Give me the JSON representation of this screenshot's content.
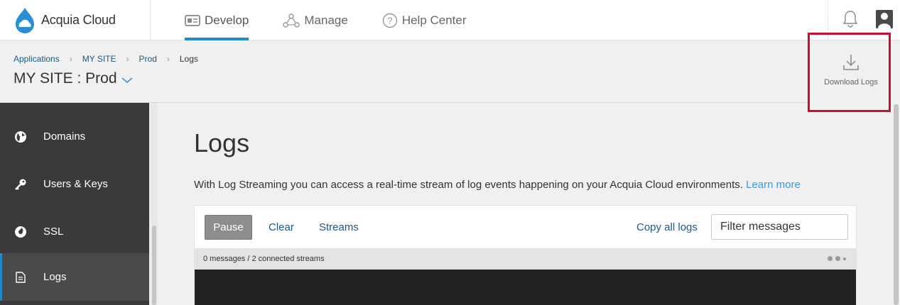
{
  "brand": {
    "name": "Acquia Cloud",
    "logo_icon": "acquia-cloud-logo"
  },
  "nav": {
    "items": [
      {
        "label": "Develop",
        "icon": "develop-icon",
        "active": true
      },
      {
        "label": "Manage",
        "icon": "manage-icon",
        "active": false
      },
      {
        "label": "Help Center",
        "icon": "help-icon",
        "active": false
      }
    ]
  },
  "breadcrumb": {
    "items": [
      "Applications",
      "MY SITE",
      "Prod"
    ],
    "current": "Logs"
  },
  "environment": {
    "title": "MY SITE : Prod"
  },
  "download": {
    "label": "Download Logs"
  },
  "sidebar": {
    "items": [
      {
        "label": "Domains",
        "icon": "globe-icon"
      },
      {
        "label": "Users & Keys",
        "icon": "key-icon"
      },
      {
        "label": "SSL",
        "icon": "ssl-gear-icon"
      },
      {
        "label": "Logs",
        "icon": "document-icon",
        "active": true
      }
    ]
  },
  "main": {
    "title": "Logs",
    "intro": "With Log Streaming you can access a real-time stream of log events happening on your Acquia Cloud environments.",
    "learn_more": "Learn more"
  },
  "log_panel": {
    "pause_label": "Pause",
    "clear_label": "Clear",
    "streams_label": "Streams",
    "copy_label": "Copy all logs",
    "filter_placeholder": "Filter messages",
    "status": "0 messages / 2 connected streams"
  },
  "colors": {
    "accent": "#1f8cc9",
    "link": "#1a5a85",
    "highlight_box": "#c8102e",
    "sidebar_bg": "#3a3a3a"
  }
}
